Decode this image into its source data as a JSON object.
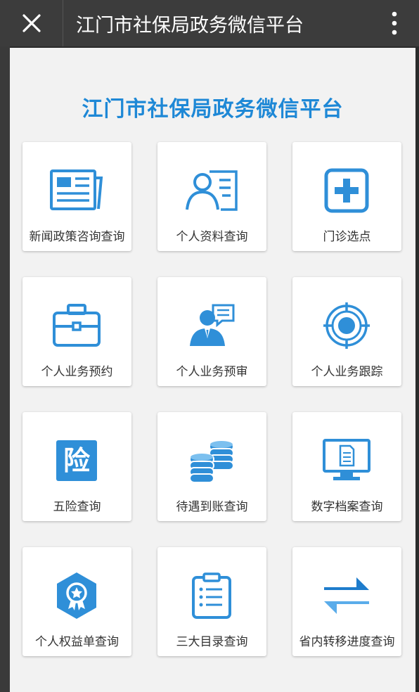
{
  "topbar": {
    "title": "江门市社保局政务微信平台",
    "close_icon": "close-icon",
    "more_icon": "more-vertical-icon"
  },
  "page": {
    "title": "江门市社保局政务微信平台"
  },
  "colors": {
    "accent": "#1e88d6",
    "icon_blue": "#2f8fd8",
    "topbar": "#3c3c3c",
    "background": "#f2f2f2"
  },
  "tiles": [
    {
      "label": "新闻政策咨询查询",
      "icon": "newspaper-icon"
    },
    {
      "label": "个人资料查询",
      "icon": "profile-card-icon"
    },
    {
      "label": "门诊选点",
      "icon": "medical-plus-icon"
    },
    {
      "label": "个人业务预约",
      "icon": "briefcase-icon"
    },
    {
      "label": "个人业务预审",
      "icon": "agent-chat-icon"
    },
    {
      "label": "个人业务跟踪",
      "icon": "target-icon"
    },
    {
      "label": "五险查询",
      "icon": "insurance-icon",
      "icon_text": "险"
    },
    {
      "label": "待遇到账查询",
      "icon": "coins-icon"
    },
    {
      "label": "数字档案查询",
      "icon": "monitor-document-icon"
    },
    {
      "label": "个人权益单查询",
      "icon": "badge-icon"
    },
    {
      "label": "三大目录查询",
      "icon": "clipboard-list-icon"
    },
    {
      "label": "省内转移进度查询",
      "icon": "transfer-arrows-icon"
    }
  ]
}
